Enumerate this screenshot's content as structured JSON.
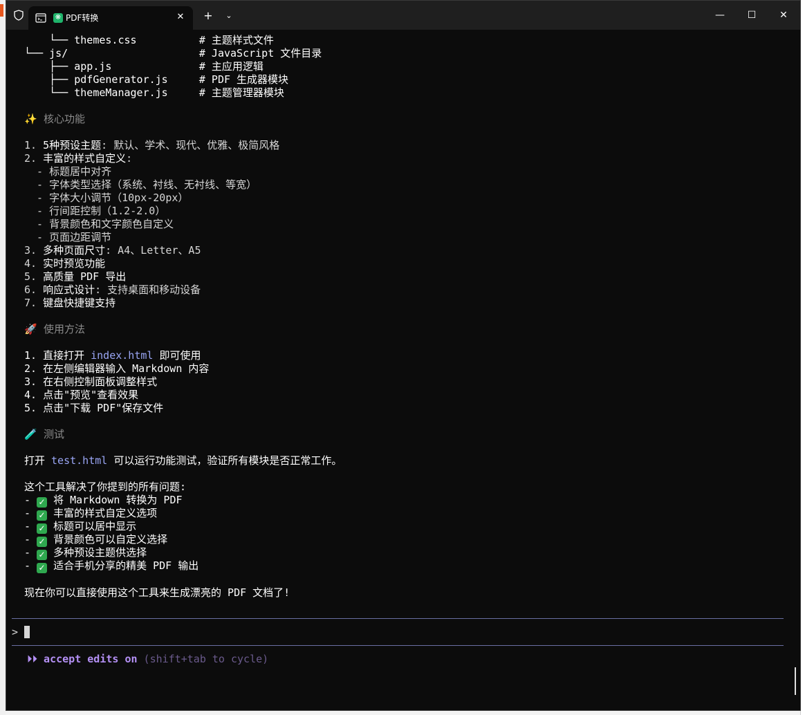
{
  "window": {
    "tab_title": "PDF转换",
    "tab_close": "✕",
    "new_tab": "+",
    "dropdown": "⌄",
    "minimize": "—",
    "maximize": "☐",
    "close": "✕",
    "app_icon_glyph": "❋"
  },
  "terminal": {
    "lines": [
      "    └── themes.css          # 主题样式文件",
      "└── js/                     # JavaScript 文件目录",
      "    ├── app.js              # 主应用逻辑",
      "    ├── pdfGenerator.js     # PDF 生成器模块",
      "    └── themeManager.js     # 主题管理器模块"
    ],
    "section_features": {
      "emoji": "✨",
      "title": "核心功能"
    },
    "features": [
      {
        "num": "1. ",
        "bold": "5种预设主题",
        "rest": ": 默认、学术、现代、优雅、极简风格"
      },
      {
        "num": "2. ",
        "bold": "丰富的样式自定义",
        "rest": ":"
      },
      {
        "num": "  - ",
        "bold": "",
        "rest": "标题居中对齐"
      },
      {
        "num": "  - ",
        "bold": "",
        "rest": "字体类型选择（系统、衬线、无衬线、等宽）"
      },
      {
        "num": "  - ",
        "bold": "",
        "rest": "字体大小调节（10px-20px）"
      },
      {
        "num": "  - ",
        "bold": "",
        "rest": "行间距控制（1.2-2.0）"
      },
      {
        "num": "  - ",
        "bold": "",
        "rest": "背景颜色和文字颜色自定义"
      },
      {
        "num": "  - ",
        "bold": "",
        "rest": "页面边距调节"
      },
      {
        "num": "3. ",
        "bold": "多种页面尺寸",
        "rest": ": A4、Letter、A5"
      },
      {
        "num": "4. ",
        "bold": "实时预览功能",
        "rest": ""
      },
      {
        "num": "5. ",
        "bold": "高质量 PDF 导出",
        "rest": ""
      },
      {
        "num": "6. ",
        "bold": "响应式设计",
        "rest": ": 支持桌面和移动设备"
      },
      {
        "num": "7. ",
        "bold": "键盘快捷键支持",
        "rest": ""
      }
    ],
    "section_usage": {
      "emoji": "🚀",
      "title": "使用方法"
    },
    "usage": [
      {
        "pre": "1. 直接打开 ",
        "code": "index.html",
        "post": " 即可使用"
      },
      {
        "pre": "2. 在左侧编辑器输入 Markdown 内容",
        "code": "",
        "post": ""
      },
      {
        "pre": "3. 在右侧控制面板调整样式",
        "code": "",
        "post": ""
      },
      {
        "pre": "4. 点击\"预览\"查看效果",
        "code": "",
        "post": ""
      },
      {
        "pre": "5. 点击\"下载 PDF\"保存文件",
        "code": "",
        "post": ""
      }
    ],
    "section_test": {
      "emoji": "🧪",
      "title": "测试"
    },
    "test_line": {
      "pre": "打开 ",
      "code": "test.html",
      "post": " 可以运行功能测试，验证所有模块是否正常工作。"
    },
    "summary_intro": "这个工具解决了你提到的所有问题:",
    "checklist": [
      "将 Markdown 转换为 PDF",
      "丰富的样式自定义选项",
      "标题可以居中显示",
      "背景颜色可以自定义选择",
      "多种预设主题供选择",
      "适合手机分享的精美 PDF 输出"
    ],
    "check_glyph": "✓",
    "closing": "现在你可以直接使用这个工具来生成漂亮的 PDF 文档了!"
  },
  "input": {
    "prompt": ">"
  },
  "status": {
    "arrows": "⏵⏵",
    "main": "accept edits on",
    "hint": "(shift+tab to cycle)"
  }
}
